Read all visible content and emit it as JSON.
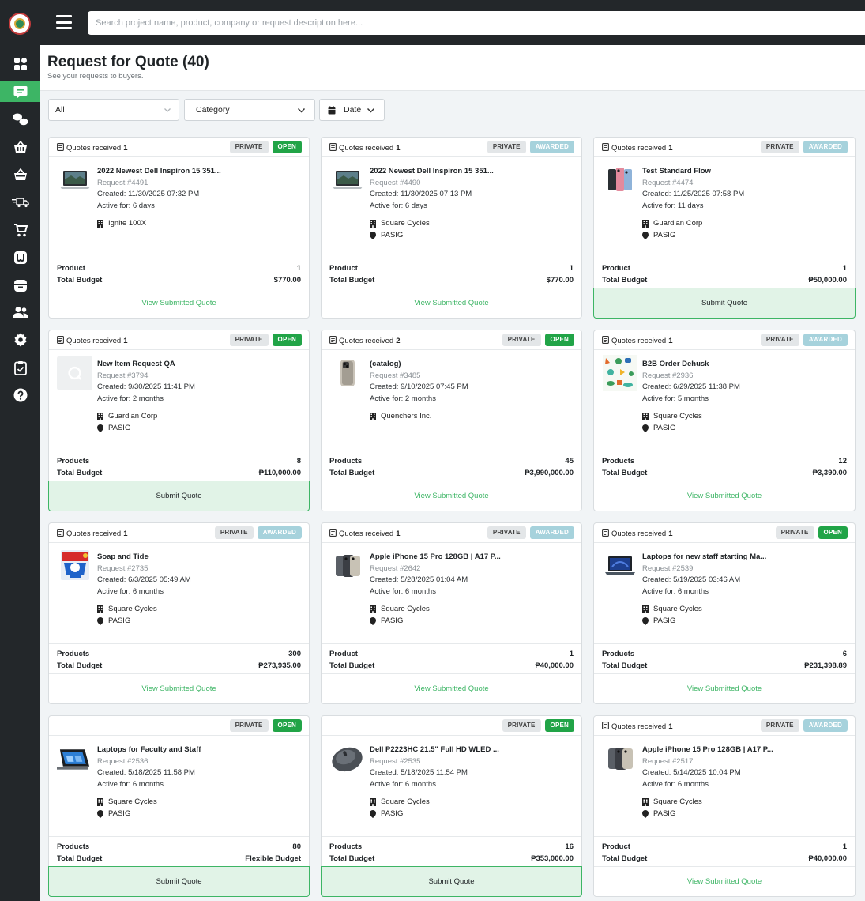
{
  "topbar": {
    "search_placeholder": "Search project name, product, company or request description here..."
  },
  "header": {
    "title": "Request for Quote (40)",
    "subtitle": "See your requests to buyers."
  },
  "filters": {
    "status": "All",
    "category": "Category",
    "date": "Date"
  },
  "sidebar": {
    "items": [
      {
        "icon": "dashboard-icon"
      },
      {
        "icon": "chat-request-icon",
        "active": true
      },
      {
        "icon": "messages-icon"
      },
      {
        "icon": "basket-icon"
      },
      {
        "icon": "basket-alt-icon"
      },
      {
        "icon": "delivery-icon"
      },
      {
        "icon": "cart-icon"
      },
      {
        "icon": "store-icon"
      },
      {
        "icon": "inbox-icon"
      },
      {
        "icon": "users-icon"
      },
      {
        "icon": "settings-icon"
      },
      {
        "icon": "clipboard-check-icon"
      },
      {
        "icon": "help-icon"
      }
    ]
  },
  "cards": [
    {
      "quotes_label": "Quotes received",
      "quotes_count": "1",
      "privacy": "PRIVATE",
      "status": "OPEN",
      "title": "2022 Newest Dell Inspiron 15 351...",
      "request": "Request #4491",
      "created": "Created: 11/30/2025 07:32 PM",
      "active": "Active for: 6 days",
      "company": "Ignite 100X",
      "location": "",
      "qty_label": "Product",
      "qty": "1",
      "budget_label": "Total Budget",
      "budget": "$770.00",
      "action": "View Submitted Quote",
      "thumb": "laptop"
    },
    {
      "quotes_label": "Quotes received",
      "quotes_count": "1",
      "privacy": "PRIVATE",
      "status": "AWARDED",
      "title": "2022 Newest Dell Inspiron 15 351...",
      "request": "Request #4490",
      "created": "Created: 11/30/2025 07:13 PM",
      "active": "Active for: 6 days",
      "company": "Square Cycles",
      "location": "PASIG",
      "qty_label": "Product",
      "qty": "1",
      "budget_label": "Total Budget",
      "budget": "$770.00",
      "action": "View Submitted Quote",
      "thumb": "laptop"
    },
    {
      "quotes_label": "Quotes received",
      "quotes_count": "1",
      "privacy": "PRIVATE",
      "status": "AWARDED",
      "title": "Test Standard Flow",
      "request": "Request #4474",
      "created": "Created: 11/25/2025 07:58 PM",
      "active": "Active for: 11 days",
      "company": "Guardian Corp",
      "location": "PASIG",
      "qty_label": "Product",
      "qty": "1",
      "budget_label": "Total Budget",
      "budget": "₱50,000.00",
      "action": "Submit Quote",
      "thumb": "phones"
    },
    {
      "quotes_label": "Quotes received",
      "quotes_count": "1",
      "privacy": "PRIVATE",
      "status": "OPEN",
      "title": "New Item Request QA",
      "request": "Request #3794",
      "created": "Created: 9/30/2025 11:41 PM",
      "active": "Active for: 2 months",
      "company": "Guardian Corp",
      "location": "PASIG",
      "qty_label": "Products",
      "qty": "8",
      "budget_label": "Total Budget",
      "budget": "₱110,000.00",
      "action": "Submit Quote",
      "thumb": "placeholder"
    },
    {
      "quotes_label": "Quotes received",
      "quotes_count": "2",
      "privacy": "PRIVATE",
      "status": "OPEN",
      "title": "(catalog)",
      "request": "Request #3485",
      "created": "Created: 9/10/2025 07:45 PM",
      "active": "Active for: 2 months",
      "company": "Quenchers Inc.",
      "location": "",
      "qty_label": "Products",
      "qty": "45",
      "budget_label": "Total Budget",
      "budget": "₱3,990,000.00",
      "action": "View Submitted Quote",
      "thumb": "iphone"
    },
    {
      "quotes_label": "Quotes received",
      "quotes_count": "1",
      "privacy": "PRIVATE",
      "status": "AWARDED",
      "title": "B2B Order Dehusk",
      "request": "Request #2936",
      "created": "Created: 6/29/2025 11:38 PM",
      "active": "Active for: 5 months",
      "company": "Square Cycles",
      "location": "PASIG",
      "qty_label": "Products",
      "qty": "12",
      "budget_label": "Total Budget",
      "budget": "₱3,390.00",
      "action": "View Submitted Quote",
      "thumb": "pattern"
    },
    {
      "quotes_label": "Quotes received",
      "quotes_count": "1",
      "privacy": "PRIVATE",
      "status": "AWARDED",
      "title": "Soap and Tide",
      "request": "Request #2735",
      "created": "Created: 6/3/2025 05:49 AM",
      "active": "Active for: 6 months",
      "company": "Square Cycles",
      "location": "PASIG",
      "qty_label": "Products",
      "qty": "300",
      "budget_label": "Total Budget",
      "budget": "₱273,935.00",
      "action": "View Submitted Quote",
      "thumb": "soap"
    },
    {
      "quotes_label": "Quotes received",
      "quotes_count": "1",
      "privacy": "PRIVATE",
      "status": "AWARDED",
      "title": "Apple iPhone 15 Pro 128GB | A17 P...",
      "request": "Request #2642",
      "created": "Created: 5/28/2025 01:04 AM",
      "active": "Active for: 6 months",
      "company": "Square Cycles",
      "location": "PASIG",
      "qty_label": "Product",
      "qty": "1",
      "budget_label": "Total Budget",
      "budget": "₱40,000.00",
      "action": "View Submitted Quote",
      "thumb": "iphone2"
    },
    {
      "quotes_label": "Quotes received",
      "quotes_count": "1",
      "privacy": "PRIVATE",
      "status": "OPEN",
      "title": "Laptops for new staff starting Ma...",
      "request": "Request #2539",
      "created": "Created: 5/19/2025 03:46 AM",
      "active": "Active for: 6 months",
      "company": "Square Cycles",
      "location": "PASIG",
      "qty_label": "Products",
      "qty": "6",
      "budget_label": "Total Budget",
      "budget": "₱231,398.89",
      "action": "View Submitted Quote",
      "thumb": "laptopblue"
    },
    {
      "quotes_label": "",
      "quotes_count": "",
      "privacy": "PRIVATE",
      "status": "OPEN",
      "title": "Laptops for Faculty and Staff",
      "request": "Request #2536",
      "created": "Created: 5/18/2025 11:58 PM",
      "active": "Active for: 6 months",
      "company": "Square Cycles",
      "location": "PASIG",
      "qty_label": "Products",
      "qty": "80",
      "budget_label": "Total Budget",
      "budget": "Flexible Budget",
      "action": "Submit Quote",
      "thumb": "surface"
    },
    {
      "quotes_label": "",
      "quotes_count": "",
      "privacy": "PRIVATE",
      "status": "OPEN",
      "title": "Dell P2223HC 21.5\" Full HD WLED ...",
      "request": "Request #2535",
      "created": "Created: 5/18/2025 11:54 PM",
      "active": "Active for: 6 months",
      "company": "Square Cycles",
      "location": "PASIG",
      "qty_label": "Products",
      "qty": "16",
      "budget_label": "Total Budget",
      "budget": "₱353,000.00",
      "action": "Submit Quote",
      "thumb": "mouse"
    },
    {
      "quotes_label": "Quotes received",
      "quotes_count": "1",
      "privacy": "PRIVATE",
      "status": "AWARDED",
      "title": "Apple iPhone 15 Pro 128GB | A17 P...",
      "request": "Request #2517",
      "created": "Created: 5/14/2025 10:04 PM",
      "active": "Active for: 6 months",
      "company": "Square Cycles",
      "location": "PASIG",
      "qty_label": "Product",
      "qty": "1",
      "budget_label": "Total Budget",
      "budget": "₱40,000.00",
      "action": "View Submitted Quote",
      "thumb": "iphone2"
    }
  ],
  "colors": {
    "accent": "#3db565",
    "open": "#21a447",
    "awarded": "#a6d2dc",
    "sidebar": "#23272a"
  }
}
